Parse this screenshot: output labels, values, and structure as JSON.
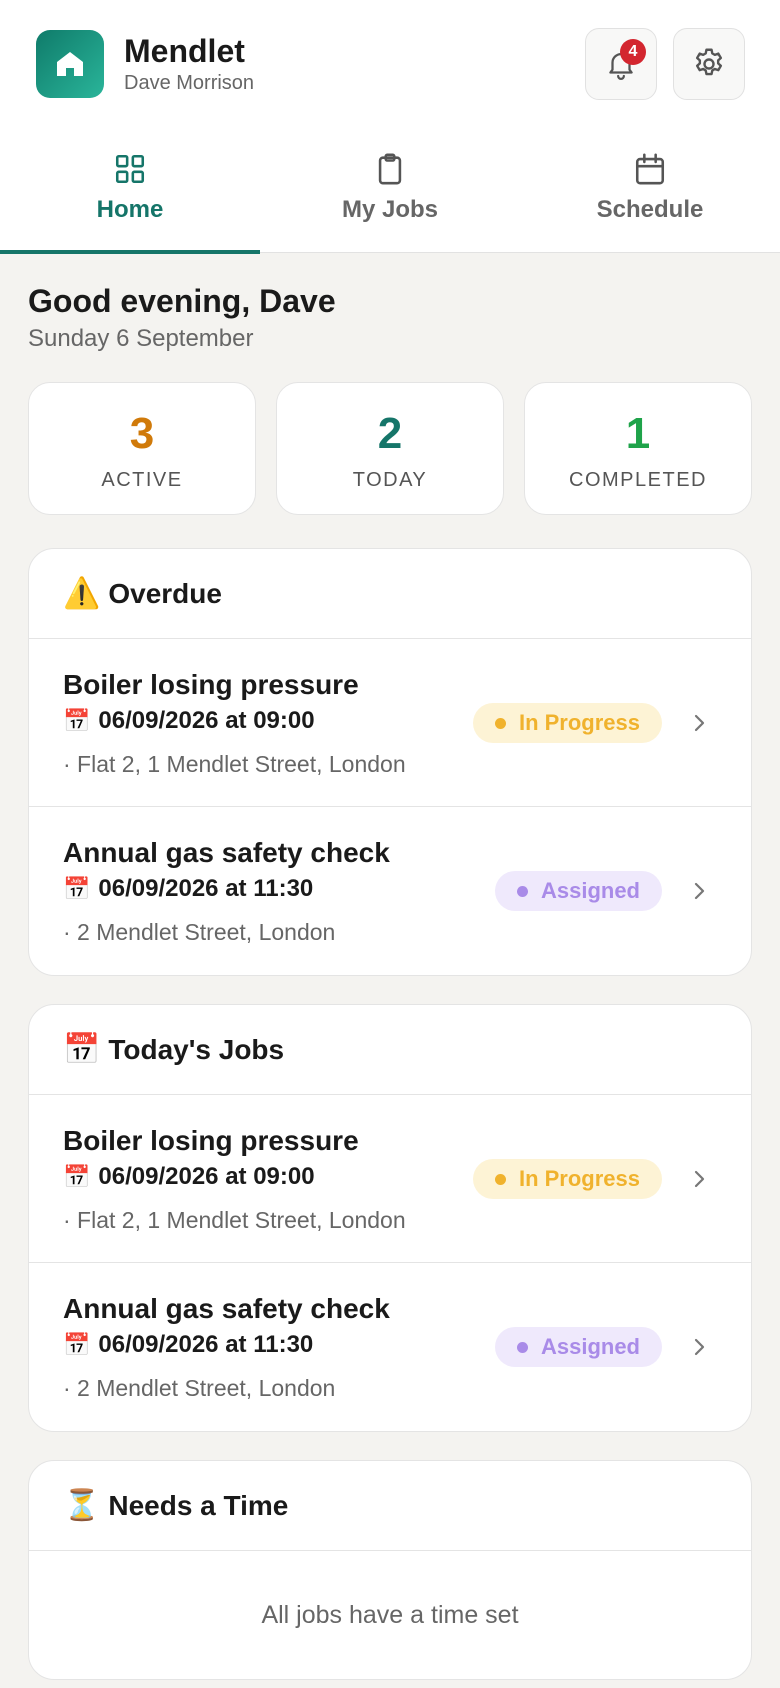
{
  "header": {
    "app_name": "Mendlet",
    "user_name": "Dave Morrison",
    "notification_count": "4",
    "brand_color": "#157569"
  },
  "tabs": [
    {
      "label": "Home",
      "icon": "grid-icon",
      "active": true
    },
    {
      "label": "My Jobs",
      "icon": "clipboard-icon",
      "active": false
    },
    {
      "label": "Schedule",
      "icon": "calendar-icon",
      "active": false
    }
  ],
  "greeting": {
    "title": "Good evening, Dave",
    "date": "Sunday 6 September"
  },
  "stats": [
    {
      "value": "3",
      "label": "ACTIVE",
      "color": "#d07a0a"
    },
    {
      "value": "2",
      "label": "TODAY",
      "color": "#157569"
    },
    {
      "value": "1",
      "label": "COMPLETED",
      "color": "#1fa34a"
    }
  ],
  "overdue": {
    "icon": "⚠️",
    "title": "Overdue",
    "jobs": [
      {
        "title": "Boiler losing pressure",
        "time": "06/09/2026 at 09:00",
        "address": "· Flat 2, 1 Mendlet Street, London",
        "status": "In Progress"
      },
      {
        "title": "Annual gas safety check",
        "time": "06/09/2026 at 11:30",
        "address": "· 2 Mendlet Street, London",
        "status": "Assigned"
      }
    ]
  },
  "today": {
    "icon": "📅",
    "title": "Today's Jobs",
    "jobs": [
      {
        "title": "Boiler losing pressure",
        "time": "06/09/2026 at 09:00",
        "address": "· Flat 2, 1 Mendlet Street, London",
        "status": "In Progress"
      },
      {
        "title": "Annual gas safety check",
        "time": "06/09/2026 at 11:30",
        "address": "· 2 Mendlet Street, London",
        "status": "Assigned"
      }
    ]
  },
  "needs_time": {
    "icon": "⏳",
    "title": "Needs a Time",
    "empty_message": "All jobs have a time set"
  },
  "calendar_glyph": "📅"
}
